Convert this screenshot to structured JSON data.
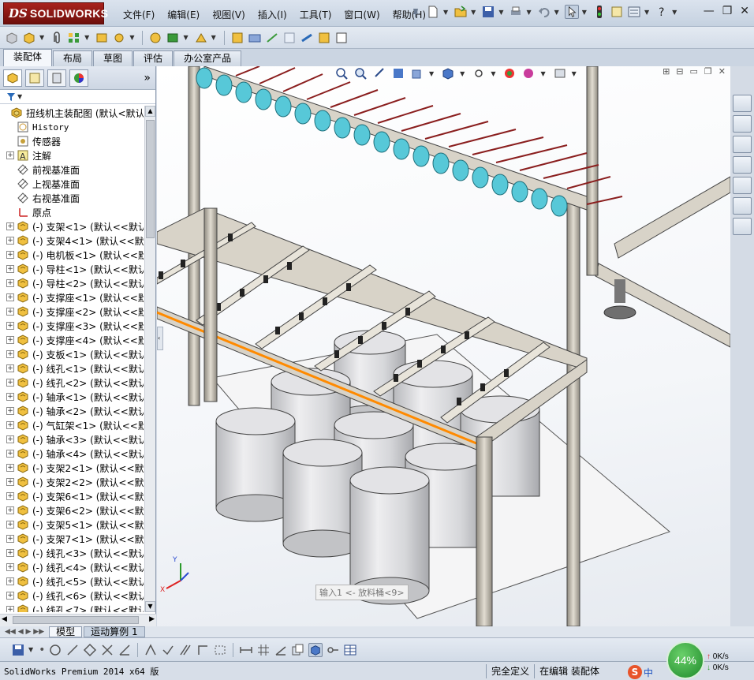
{
  "app": {
    "logo_ds": "DS",
    "logo_name": "SOLIDWORKS"
  },
  "menu": [
    "文件(F)",
    "编辑(E)",
    "视图(V)",
    "插入(I)",
    "工具(T)",
    "窗口(W)",
    "帮助(H)"
  ],
  "command_tabs": [
    {
      "label": "装配体",
      "active": true
    },
    {
      "label": "布局",
      "active": false
    },
    {
      "label": "草图",
      "active": false
    },
    {
      "label": "评估",
      "active": false
    },
    {
      "label": "办公室产品",
      "active": false
    }
  ],
  "feature_tree": {
    "root": "扭线机主装配图  (默认<默认",
    "items": [
      {
        "label": "History",
        "icon": "history-icon",
        "expander": false,
        "mono": true
      },
      {
        "label": "传感器",
        "icon": "sensor-icon",
        "expander": false
      },
      {
        "label": "注解",
        "icon": "annotation-icon",
        "expander": true
      },
      {
        "label": "前视基准面",
        "icon": "plane-icon",
        "expander": false
      },
      {
        "label": "上视基准面",
        "icon": "plane-icon",
        "expander": false
      },
      {
        "label": "右视基准面",
        "icon": "plane-icon",
        "expander": false
      },
      {
        "label": "原点",
        "icon": "origin-icon",
        "expander": false
      },
      {
        "label": "(-) 支架<1>  (默认<<默认",
        "icon": "part-icon",
        "expander": true
      },
      {
        "label": "(-) 支架4<1>  (默认<<默认",
        "icon": "part-icon",
        "expander": true
      },
      {
        "label": "(-) 电机板<1>  (默认<<默",
        "icon": "part-icon",
        "expander": true
      },
      {
        "label": "(-) 导柱<1>  (默认<<默认",
        "icon": "part-icon",
        "expander": true
      },
      {
        "label": "(-) 导柱<2>  (默认<<默认",
        "icon": "part-icon",
        "expander": true
      },
      {
        "label": "(-) 支撑座<1>  (默认<<默",
        "icon": "part-icon",
        "expander": true
      },
      {
        "label": "(-) 支撑座<2>  (默认<<默",
        "icon": "part-icon",
        "expander": true
      },
      {
        "label": "(-) 支撑座<3>  (默认<<默",
        "icon": "part-icon",
        "expander": true
      },
      {
        "label": "(-) 支撑座<4>  (默认<<默",
        "icon": "part-icon",
        "expander": true
      },
      {
        "label": "(-) 支板<1>  (默认<<默认",
        "icon": "part-icon",
        "expander": true
      },
      {
        "label": "(-) 线孔<1>  (默认<<默认",
        "icon": "part-icon",
        "expander": true
      },
      {
        "label": "(-) 线孔<2>  (默认<<默认",
        "icon": "part-icon",
        "expander": true
      },
      {
        "label": "(-) 轴承<1>  (默认<<默认",
        "icon": "part-icon",
        "expander": true
      },
      {
        "label": "(-) 轴承<2>  (默认<<默认",
        "icon": "part-icon",
        "expander": true
      },
      {
        "label": "(-) 气缸架<1>  (默认<<默",
        "icon": "part-icon",
        "expander": true
      },
      {
        "label": "(-) 轴承<3>  (默认<<默认",
        "icon": "part-icon",
        "expander": true
      },
      {
        "label": "(-) 轴承<4>  (默认<<默认",
        "icon": "part-icon",
        "expander": true
      },
      {
        "label": "(-) 支架2<1>  (默认<<默认",
        "icon": "part-icon",
        "expander": true
      },
      {
        "label": "(-) 支架2<2>  (默认<<默认",
        "icon": "part-icon",
        "expander": true
      },
      {
        "label": "(-) 支架6<1>  (默认<<默认",
        "icon": "part-icon",
        "expander": true
      },
      {
        "label": "(-) 支架6<2>  (默认<<默认",
        "icon": "part-icon",
        "expander": true
      },
      {
        "label": "(-) 支架5<1>  (默认<<默认",
        "icon": "part-icon",
        "expander": true
      },
      {
        "label": "(-) 支架7<1>  (默认<<默认",
        "icon": "part-icon",
        "expander": true
      },
      {
        "label": "(-) 线孔<3>  (默认<<默认",
        "icon": "part-icon",
        "expander": true
      },
      {
        "label": "(-) 线孔<4>  (默认<<默认",
        "icon": "part-icon",
        "expander": true
      },
      {
        "label": "(-) 线孔<5>  (默认<<默认",
        "icon": "part-icon",
        "expander": true
      },
      {
        "label": "(-) 线孔<6>  (默认<<默认",
        "icon": "part-icon",
        "expander": true
      },
      {
        "label": "(-) 线孔<7>  (默认<<默认",
        "icon": "part-icon",
        "expander": true
      }
    ]
  },
  "viewport": {
    "tooltip": "输入1 <- 放料桶<9>",
    "triad_x": "X",
    "triad_y": "Y"
  },
  "model_tabs": [
    {
      "label": "模型",
      "active": false
    },
    {
      "label": "运动算例 1",
      "active": true
    }
  ],
  "status": {
    "product": "SolidWorks Premium 2014 x64 版",
    "definition": "完全定义",
    "mode": "在编辑 装配体"
  },
  "network": {
    "percent": "44%",
    "up": "0K/s",
    "down": "0K/s"
  },
  "ime": {
    "label": "中"
  },
  "colors": {
    "frame": "#c9c2b4",
    "accent_edge": "#ff8a00",
    "fan_blade": "#57c8d8",
    "barrel": "#d9d9db"
  }
}
